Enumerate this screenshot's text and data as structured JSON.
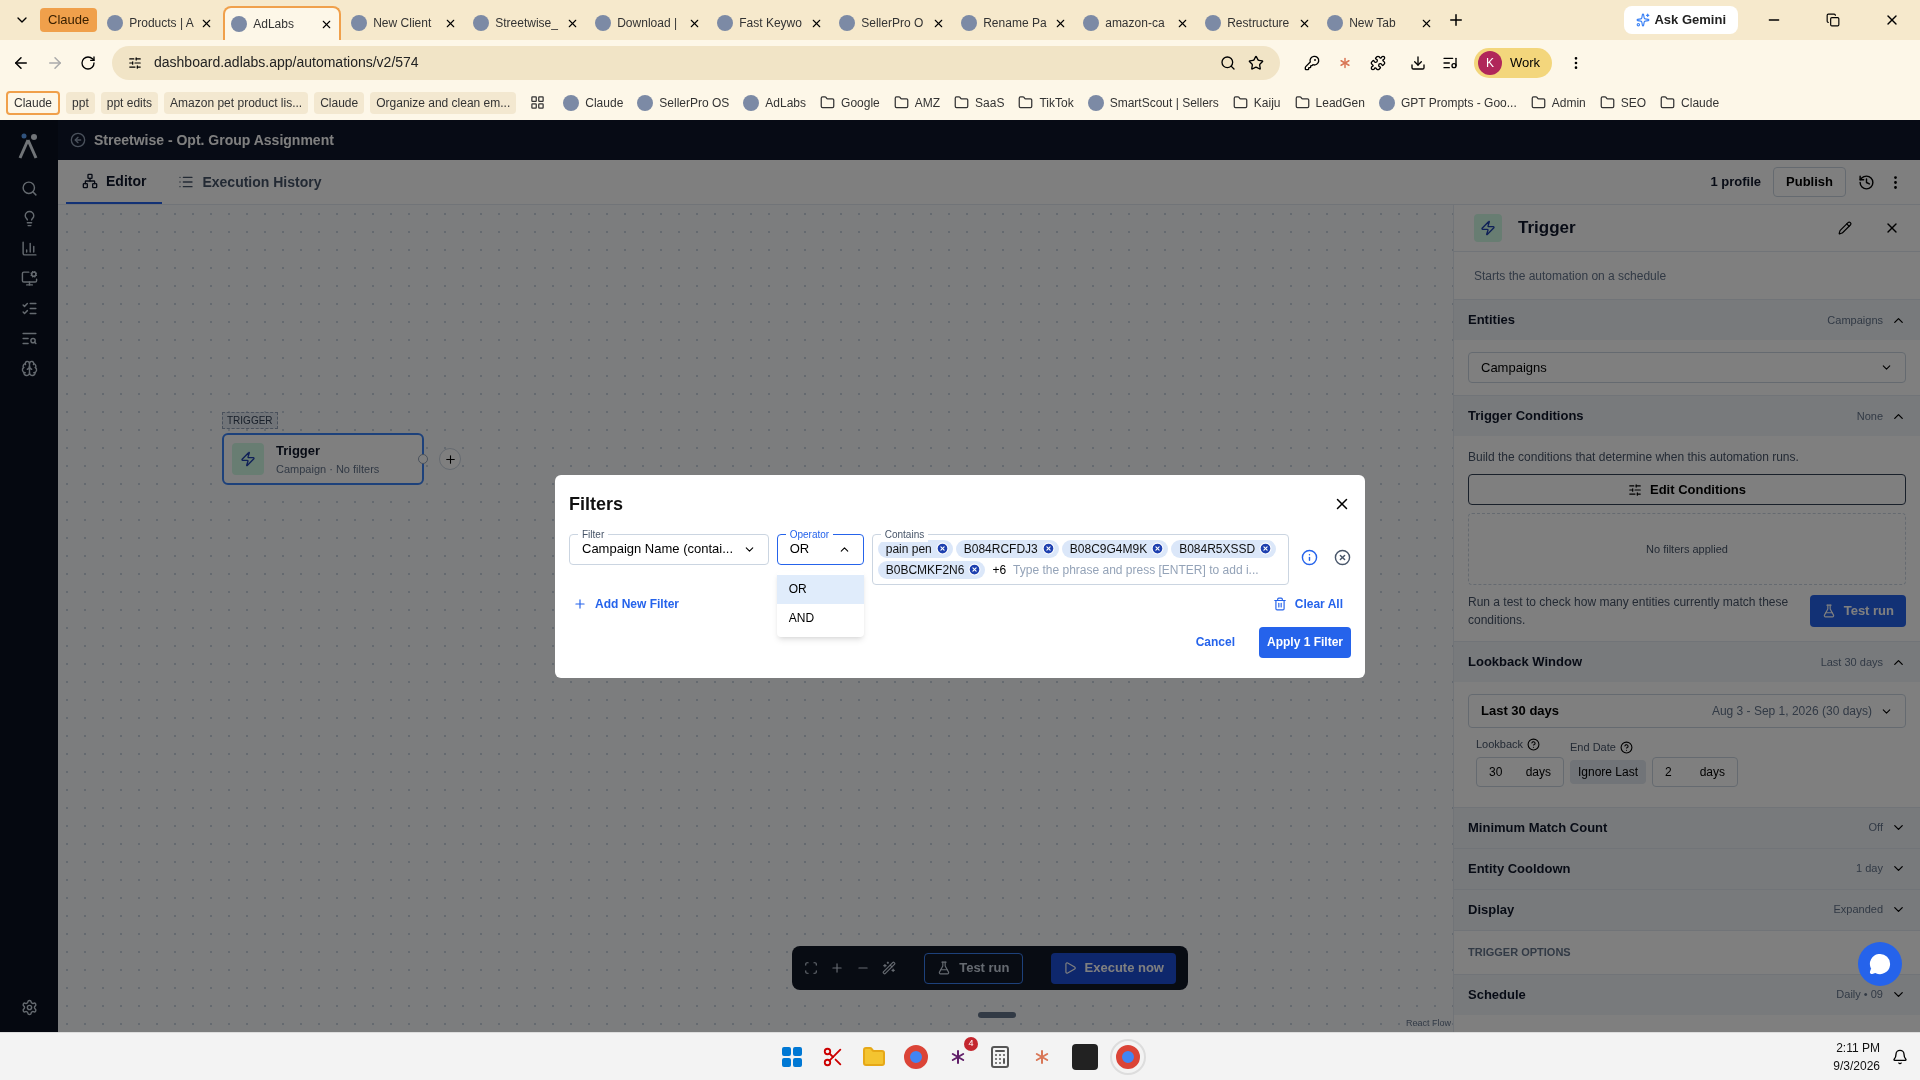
{
  "browser": {
    "tab_group": "Claude",
    "tabs": [
      {
        "title": "Products | A",
        "selected": false
      },
      {
        "title": "AdLabs",
        "selected": true
      },
      {
        "title": "New Client",
        "selected": false
      },
      {
        "title": "Streetwise_",
        "selected": false
      },
      {
        "title": "Download |",
        "selected": false
      },
      {
        "title": "Fast Keywo",
        "selected": false
      },
      {
        "title": "SellerPro O",
        "selected": false
      },
      {
        "title": "Rename Pa",
        "selected": false
      },
      {
        "title": "amazon-ca",
        "selected": false
      },
      {
        "title": "Restructure",
        "selected": false
      },
      {
        "title": "New Tab",
        "selected": false
      }
    ],
    "ask_gemini": "Ask Gemini",
    "url": "dashboard.adlabs.app/automations/v2/574",
    "profile": {
      "initial": "K",
      "label": "Work"
    }
  },
  "bookmarks": [
    {
      "kind": "group",
      "label": "Claude"
    },
    {
      "kind": "plain",
      "label": "ppt"
    },
    {
      "kind": "plain",
      "label": "ppt edits"
    },
    {
      "kind": "plain",
      "label": "Amazon pet product lis..."
    },
    {
      "kind": "plain",
      "label": "Claude"
    },
    {
      "kind": "plain",
      "label": "Organize and clean em..."
    },
    {
      "kind": "apps"
    },
    {
      "kind": "site",
      "label": "Claude"
    },
    {
      "kind": "site",
      "label": "SellerPro OS"
    },
    {
      "kind": "site",
      "label": "AdLabs"
    },
    {
      "kind": "folder",
      "label": "Google"
    },
    {
      "kind": "folder",
      "label": "AMZ"
    },
    {
      "kind": "folder",
      "label": "SaaS"
    },
    {
      "kind": "folder",
      "label": "TikTok"
    },
    {
      "kind": "site",
      "label": "SmartScout | Sellers"
    },
    {
      "kind": "folder",
      "label": "Kaiju"
    },
    {
      "kind": "folder",
      "label": "LeadGen"
    },
    {
      "kind": "site",
      "label": "GPT Prompts - Goo..."
    },
    {
      "kind": "folder",
      "label": "Admin"
    },
    {
      "kind": "folder",
      "label": "SEO"
    },
    {
      "kind": "folder",
      "label": "Claude"
    }
  ],
  "app": {
    "title": "Streetwise - Opt. Group Assignment",
    "tabs": [
      {
        "label": "Editor",
        "selected": true
      },
      {
        "label": "Execution History",
        "selected": false
      }
    ],
    "profile_count": "1 profile",
    "publish": "Publish"
  },
  "canvas": {
    "node_badge": "TRIGGER",
    "node_title": "Trigger",
    "node_subtitle": "Campaign · No filters",
    "attribution": "React Flow",
    "test_run": "Test run",
    "execute": "Execute now"
  },
  "panel": {
    "title": "Trigger",
    "description": "Starts the automation on a schedule",
    "sections": [
      {
        "kind": "entities",
        "title": "Entities",
        "value": "Campaigns",
        "expanded": true,
        "select": "Campaigns"
      },
      {
        "kind": "conditions",
        "title": "Trigger Conditions",
        "value": "None",
        "expanded": true,
        "hint": "Build the conditions that determine when this automation runs.",
        "edit": "Edit Conditions",
        "empty": "No filters applied",
        "test_hint": "Run a test to check how many entities currently match these conditions.",
        "test_run": "Test run"
      },
      {
        "kind": "lookback",
        "title": "Lookback Window",
        "value": "Last 30 days",
        "expanded": true,
        "select": "Last 30 days",
        "range": "Aug 3 - Sep 1, 2026 (30 days)",
        "lookback_label": "Lookback",
        "lookback_value": "30",
        "lookback_unit": "days",
        "end_label": "End Date",
        "ignore": "Ignore Last",
        "end_value": "2",
        "end_unit": "days"
      },
      {
        "kind": "plain",
        "title": "Minimum Match Count",
        "value": "Off",
        "expanded": false
      },
      {
        "kind": "plain",
        "title": "Entity Cooldown",
        "value": "1 day",
        "expanded": false
      },
      {
        "kind": "plain",
        "title": "Display",
        "value": "Expanded",
        "expanded": false
      },
      {
        "kind": "heading",
        "title": "TRIGGER OPTIONS"
      },
      {
        "kind": "plain",
        "title": "Schedule",
        "value": "Daily • 09",
        "expanded": false
      }
    ]
  },
  "modal": {
    "title": "Filters",
    "filter": {
      "label": "Filter",
      "value": "Campaign Name (contai..."
    },
    "operator": {
      "label": "Operator",
      "value": "OR",
      "expanded": true,
      "options": [
        {
          "label": "OR",
          "selected": true
        },
        {
          "label": "AND",
          "selected": false
        }
      ]
    },
    "contains": {
      "label": "Contains",
      "chips": [
        "pain pen",
        "B084RCFDJ3",
        "B08C9G4M9K",
        "B084R5XSSD",
        "B0BCMKF2N6"
      ],
      "more": "+6",
      "placeholder": "Type the phrase and press [ENTER] to add i..."
    },
    "add_filter": "Add New Filter",
    "clear_all": "Clear All",
    "cancel": "Cancel",
    "apply": "Apply 1 Filter"
  },
  "taskbar": {
    "badge": "4",
    "time": "2:11 PM",
    "date": "9/3/2026"
  }
}
